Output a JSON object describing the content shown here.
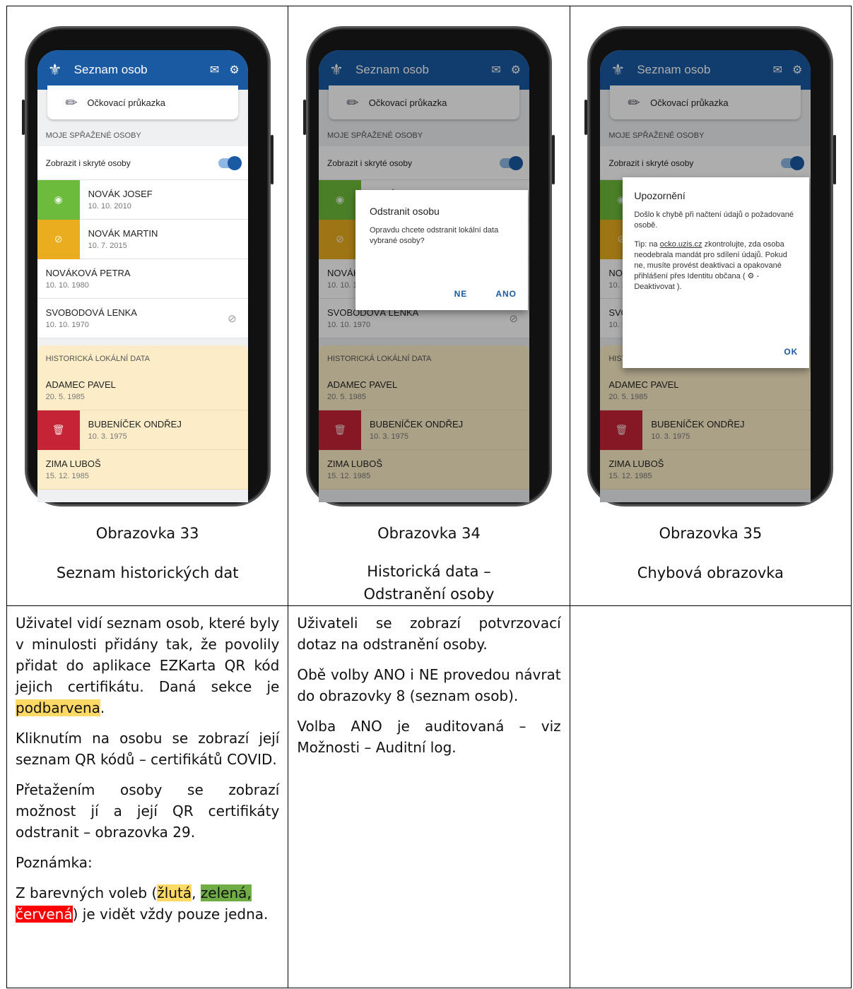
{
  "phone": {
    "app_title": "Seznam osob",
    "vaccination_card": "Očkovací průkazka",
    "linked_section": "MOJE SPŘAŽENÉ OSOBY",
    "toggle_label": "Zobrazit i skryté osoby",
    "persons": [
      {
        "name": "NOVÁK JOSEF",
        "date": "10. 10. 2010"
      },
      {
        "name": "NOVÁK MARTIN",
        "date": "10. 7. 2015"
      },
      {
        "name": "NOVÁKOVÁ PETRA",
        "date": "10. 10. 1980"
      },
      {
        "name": "SVOBODOVÁ LENKA",
        "date": "10. 10. 1970"
      }
    ],
    "history_section": "HISTORICKÁ LOKÁLNÍ DATA",
    "history": [
      {
        "name": "ADAMEC PAVEL",
        "date": "20. 5. 1985"
      },
      {
        "name": "BUBENÍČEK ONDŘEJ",
        "date": "10. 3. 1975"
      },
      {
        "name": "ZIMA LUBOŠ",
        "date": "15. 12. 1985"
      }
    ]
  },
  "dialog_remove": {
    "title": "Odstranit osobu",
    "body": "Opravdu chcete odstranit lokální data vybrané osoby?",
    "no": "NE",
    "yes": "ANO"
  },
  "dialog_error": {
    "title": "Upozornění",
    "line1": "Došlo k chybě při načtení údajů o požadované osobě.",
    "tip_prefix": "Tip: na ",
    "tip_link": "ocko.uzis.cz",
    "tip_rest": " zkontrolujte, zda osoba neodebrala mandát pro sdílení údajů. Pokud ne, musíte provést deaktivaci a opakované přihlášení přes Identitu občana (",
    "tip_gear_label": " - Deaktivovat ).",
    "ok": "OK"
  },
  "captions": [
    {
      "num": "Obrazovka 33",
      "title": "Seznam historických dat"
    },
    {
      "num": "Obrazovka 34",
      "title": "Historická data – Odstranění osoby"
    },
    {
      "num": "Obrazovka 35",
      "title": "Chybová obrazovka"
    }
  ],
  "desc1": {
    "p1_a": "Uživatel vidí seznam osob, které byly v minulosti přidány tak, že povolily přidat do aplikace EZKarta QR kód jejich certifikátu. Daná sekce je ",
    "p1_hl": "podbarvena",
    "p1_b": ".",
    "p2": "Kliknutím na osobu se zobrazí její seznam QR kódů – certifikátů COVID.",
    "p3": "Přetažením osoby se zobrazí možnost jí a její QR certifikáty odstranit – obrazovka 29.",
    "p4": "Poznámka:",
    "p5_a": "Z barevných voleb (",
    "p5_y": "žlutá",
    "p5_sep": ", ",
    "p5_g": "zelená,",
    "p5_sp": " ",
    "p5_r": "červená",
    "p5_b": ") je vidět vždy pouze jedna."
  },
  "desc2": {
    "p1": "Uživateli se zobrazí potvrzovací dotaz na odstranění osoby.",
    "p2": "Obě volby ANO i NE provedou návrat do obrazovky 8 (seznam osob).",
    "p3": "Volba ANO je auditovaná – viz Možnosti – Auditní log."
  },
  "colors": {
    "appbar": "#1a5aa3",
    "history_bg": "#fcedc8",
    "green": "#6dbb3c",
    "yellow": "#e9ad1f",
    "red": "#c42435"
  },
  "icons": [
    "state-logo-icon",
    "mail-icon",
    "gear-icon",
    "syringe-icon",
    "eye-icon",
    "eye-off-icon",
    "trash-icon"
  ]
}
